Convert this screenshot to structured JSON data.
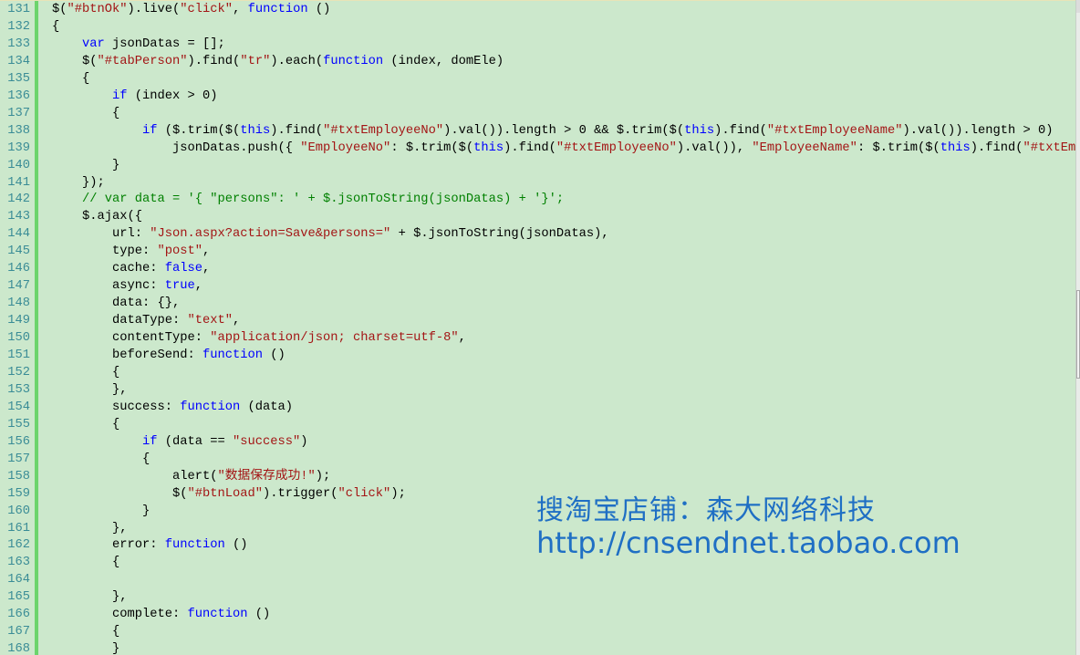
{
  "editor": {
    "colors": {
      "background": "#cce8cc",
      "keyword": "#0000ff",
      "string": "#a31515",
      "comment": "#008000",
      "line_number": "#3a8c96",
      "change_bar": "#6cd46c"
    },
    "lines": [
      {
        "n": "131",
        "i": 0,
        "t": [
          [
            "p",
            "$("
          ],
          [
            "s",
            "\"#btnOk\""
          ],
          [
            "p",
            ").live("
          ],
          [
            "s",
            "\"click\""
          ],
          [
            "p",
            ", "
          ],
          [
            "k",
            "function"
          ],
          [
            "p",
            " ()"
          ]
        ]
      },
      {
        "n": "132",
        "i": 0,
        "t": [
          [
            "p",
            "{"
          ]
        ]
      },
      {
        "n": "133",
        "i": 1,
        "t": [
          [
            "k",
            "var"
          ],
          [
            "p",
            " jsonDatas = [];"
          ]
        ]
      },
      {
        "n": "134",
        "i": 1,
        "t": [
          [
            "p",
            "$("
          ],
          [
            "s",
            "\"#tabPerson\""
          ],
          [
            "p",
            ").find("
          ],
          [
            "s",
            "\"tr\""
          ],
          [
            "p",
            ").each("
          ],
          [
            "k",
            "function"
          ],
          [
            "p",
            " (index, domEle)"
          ]
        ]
      },
      {
        "n": "135",
        "i": 1,
        "t": [
          [
            "p",
            "{"
          ]
        ]
      },
      {
        "n": "136",
        "i": 2,
        "t": [
          [
            "k",
            "if"
          ],
          [
            "p",
            " (index > 0)"
          ]
        ]
      },
      {
        "n": "137",
        "i": 2,
        "t": [
          [
            "p",
            "{"
          ]
        ]
      },
      {
        "n": "138",
        "i": 3,
        "t": [
          [
            "k",
            "if"
          ],
          [
            "p",
            " ($.trim($("
          ],
          [
            "k",
            "this"
          ],
          [
            "p",
            ").find("
          ],
          [
            "s",
            "\"#txtEmployeeNo\""
          ],
          [
            "p",
            ").val()).length > 0 && $.trim($("
          ],
          [
            "k",
            "this"
          ],
          [
            "p",
            ").find("
          ],
          [
            "s",
            "\"#txtEmployeeName\""
          ],
          [
            "p",
            ").val()).length > 0)"
          ]
        ]
      },
      {
        "n": "139",
        "i": 4,
        "t": [
          [
            "p",
            "jsonDatas.push({ "
          ],
          [
            "s",
            "\"EmployeeNo\""
          ],
          [
            "p",
            ": $.trim($("
          ],
          [
            "k",
            "this"
          ],
          [
            "p",
            ").find("
          ],
          [
            "s",
            "\"#txtEmployeeNo\""
          ],
          [
            "p",
            ").val()), "
          ],
          [
            "s",
            "\"EmployeeName\""
          ],
          [
            "p",
            ": $.trim($("
          ],
          [
            "k",
            "this"
          ],
          [
            "p",
            ").find("
          ],
          [
            "s",
            "\"#txtEmploye"
          ]
        ]
      },
      {
        "n": "140",
        "i": 2,
        "t": [
          [
            "p",
            "}"
          ]
        ]
      },
      {
        "n": "141",
        "i": 1,
        "t": [
          [
            "p",
            "});"
          ]
        ]
      },
      {
        "n": "142",
        "i": 1,
        "t": [
          [
            "c",
            "// var data = '{ \"persons\": ' + $.jsonToString(jsonDatas) + '}';"
          ]
        ]
      },
      {
        "n": "143",
        "i": 1,
        "t": [
          [
            "p",
            "$.ajax({"
          ]
        ]
      },
      {
        "n": "144",
        "i": 2,
        "t": [
          [
            "p",
            "url: "
          ],
          [
            "s",
            "\"Json.aspx?action=Save&persons=\""
          ],
          [
            "p",
            " + $.jsonToString(jsonDatas),"
          ]
        ]
      },
      {
        "n": "145",
        "i": 2,
        "t": [
          [
            "p",
            "type: "
          ],
          [
            "s",
            "\"post\""
          ],
          [
            "p",
            ","
          ]
        ]
      },
      {
        "n": "146",
        "i": 2,
        "t": [
          [
            "p",
            "cache: "
          ],
          [
            "k",
            "false"
          ],
          [
            "p",
            ","
          ]
        ]
      },
      {
        "n": "147",
        "i": 2,
        "t": [
          [
            "p",
            "async: "
          ],
          [
            "k",
            "true"
          ],
          [
            "p",
            ","
          ]
        ]
      },
      {
        "n": "148",
        "i": 2,
        "t": [
          [
            "p",
            "data: {},"
          ]
        ]
      },
      {
        "n": "149",
        "i": 2,
        "t": [
          [
            "p",
            "dataType: "
          ],
          [
            "s",
            "\"text\""
          ],
          [
            "p",
            ","
          ]
        ]
      },
      {
        "n": "150",
        "i": 2,
        "t": [
          [
            "p",
            "contentType: "
          ],
          [
            "s",
            "\"application/json; charset=utf-8\""
          ],
          [
            "p",
            ","
          ]
        ]
      },
      {
        "n": "151",
        "i": 2,
        "t": [
          [
            "p",
            "beforeSend: "
          ],
          [
            "k",
            "function"
          ],
          [
            "p",
            " ()"
          ]
        ]
      },
      {
        "n": "152",
        "i": 2,
        "t": [
          [
            "p",
            "{"
          ]
        ]
      },
      {
        "n": "153",
        "i": 2,
        "t": [
          [
            "p",
            "},"
          ]
        ]
      },
      {
        "n": "154",
        "i": 2,
        "t": [
          [
            "p",
            "success: "
          ],
          [
            "k",
            "function"
          ],
          [
            "p",
            " (data)"
          ]
        ]
      },
      {
        "n": "155",
        "i": 2,
        "t": [
          [
            "p",
            "{"
          ]
        ]
      },
      {
        "n": "156",
        "i": 3,
        "t": [
          [
            "k",
            "if"
          ],
          [
            "p",
            " (data == "
          ],
          [
            "s",
            "\"success\""
          ],
          [
            "p",
            ")"
          ]
        ]
      },
      {
        "n": "157",
        "i": 3,
        "t": [
          [
            "p",
            "{"
          ]
        ]
      },
      {
        "n": "158",
        "i": 4,
        "t": [
          [
            "p",
            "alert("
          ],
          [
            "s",
            "\"数据保存成功!\""
          ],
          [
            "p",
            ");"
          ]
        ]
      },
      {
        "n": "159",
        "i": 4,
        "t": [
          [
            "p",
            "$("
          ],
          [
            "s",
            "\"#btnLoad\""
          ],
          [
            "p",
            ").trigger("
          ],
          [
            "s",
            "\"click\""
          ],
          [
            "p",
            ");"
          ]
        ]
      },
      {
        "n": "160",
        "i": 3,
        "t": [
          [
            "p",
            "}"
          ]
        ]
      },
      {
        "n": "161",
        "i": 2,
        "t": [
          [
            "p",
            "},"
          ]
        ]
      },
      {
        "n": "162",
        "i": 2,
        "t": [
          [
            "p",
            "error: "
          ],
          [
            "k",
            "function"
          ],
          [
            "p",
            " ()"
          ]
        ]
      },
      {
        "n": "163",
        "i": 2,
        "t": [
          [
            "p",
            "{"
          ]
        ]
      },
      {
        "n": "164",
        "i": 2,
        "t": []
      },
      {
        "n": "165",
        "i": 2,
        "t": [
          [
            "p",
            "},"
          ]
        ]
      },
      {
        "n": "166",
        "i": 2,
        "t": [
          [
            "p",
            "complete: "
          ],
          [
            "k",
            "function"
          ],
          [
            "p",
            " ()"
          ]
        ]
      },
      {
        "n": "167",
        "i": 2,
        "t": [
          [
            "p",
            "{"
          ]
        ]
      },
      {
        "n": "168",
        "i": 2,
        "t": [
          [
            "p",
            "}"
          ]
        ]
      }
    ]
  },
  "watermark": {
    "line1": "搜淘宝店铺：森大网络科技",
    "line2": "http://cnsendnet.taobao.com"
  }
}
